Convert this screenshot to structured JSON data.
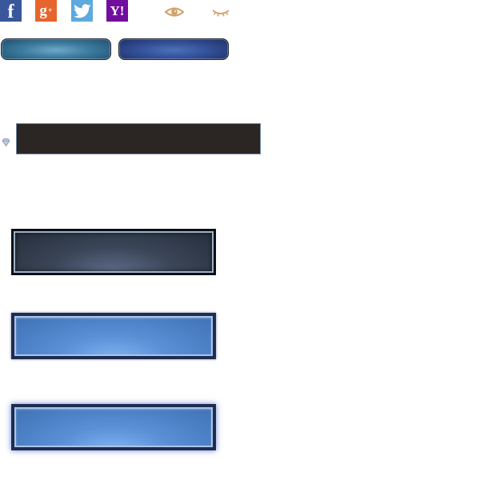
{
  "social": {
    "facebook": {
      "glyph": "f",
      "color": "#39579a",
      "icon": "facebook-icon"
    },
    "google_plus": {
      "glyph": "g",
      "sup": "+",
      "color": "#e7642c",
      "icon": "google-plus-icon"
    },
    "twitter": {
      "color": "#5ea9dd",
      "icon": "twitter-icon"
    },
    "yahoo": {
      "glyph": "Y!",
      "color": "#720e9e",
      "icon": "yahoo-icon"
    }
  },
  "visibility": {
    "eye_open": {
      "icon": "eye-open-icon",
      "color": "#d2a46c"
    },
    "eye_closed": {
      "icon": "eye-closed-icon",
      "color": "#d2a46c"
    }
  },
  "pills": [
    {
      "icon": "teal-pill-button",
      "color": "#3c7b9f"
    },
    {
      "icon": "blue-pill-button",
      "color": "#34519a"
    }
  ],
  "field": {
    "value": "",
    "color": "#2b2623"
  },
  "frames": [
    {
      "variant": "dark",
      "color": "#3a4558"
    },
    {
      "variant": "blue",
      "color": "#5a8fd6"
    },
    {
      "variant": "blue-glow",
      "color": "#5a8fd6"
    }
  ]
}
